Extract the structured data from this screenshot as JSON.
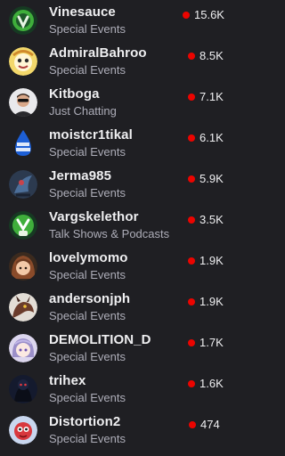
{
  "live_dot_color": "#eb0400",
  "channels": [
    {
      "name": "Vinesauce",
      "category": "Special Events",
      "viewers": "15.6K",
      "avatar_icon": "vinesauce-vine-logo-icon"
    },
    {
      "name": "AdmiralBahroo",
      "category": "Special Events",
      "viewers": "8.5K",
      "avatar_icon": "cartoon-face-icon"
    },
    {
      "name": "Kitboga",
      "category": "Just Chatting",
      "viewers": "7.1K",
      "avatar_icon": "person-sunglasses-icon"
    },
    {
      "name": "moistcr1tikal",
      "category": "Special Events",
      "viewers": "6.1K",
      "avatar_icon": "big-moist-logo-icon"
    },
    {
      "name": "Jerma985",
      "category": "Special Events",
      "viewers": "5.9K",
      "avatar_icon": "dark-character-icon"
    },
    {
      "name": "Vargskelethor",
      "category": "Talk Shows & Podcasts",
      "viewers": "3.5K",
      "avatar_icon": "vinesauce-vine-logo-icon"
    },
    {
      "name": "lovelymomo",
      "category": "Special Events",
      "viewers": "1.9K",
      "avatar_icon": "anime-girl-icon"
    },
    {
      "name": "andersonjph",
      "category": "Special Events",
      "viewers": "1.9K",
      "avatar_icon": "dragon-creature-icon"
    },
    {
      "name": "DEMOLITION_D",
      "category": "Special Events",
      "viewers": "1.7K",
      "avatar_icon": "anime-character-icon"
    },
    {
      "name": "trihex",
      "category": "Special Events",
      "viewers": "1.6K",
      "avatar_icon": "dark-figure-icon"
    },
    {
      "name": "Distortion2",
      "category": "Special Events",
      "viewers": "474",
      "avatar_icon": "red-character-icon"
    }
  ]
}
